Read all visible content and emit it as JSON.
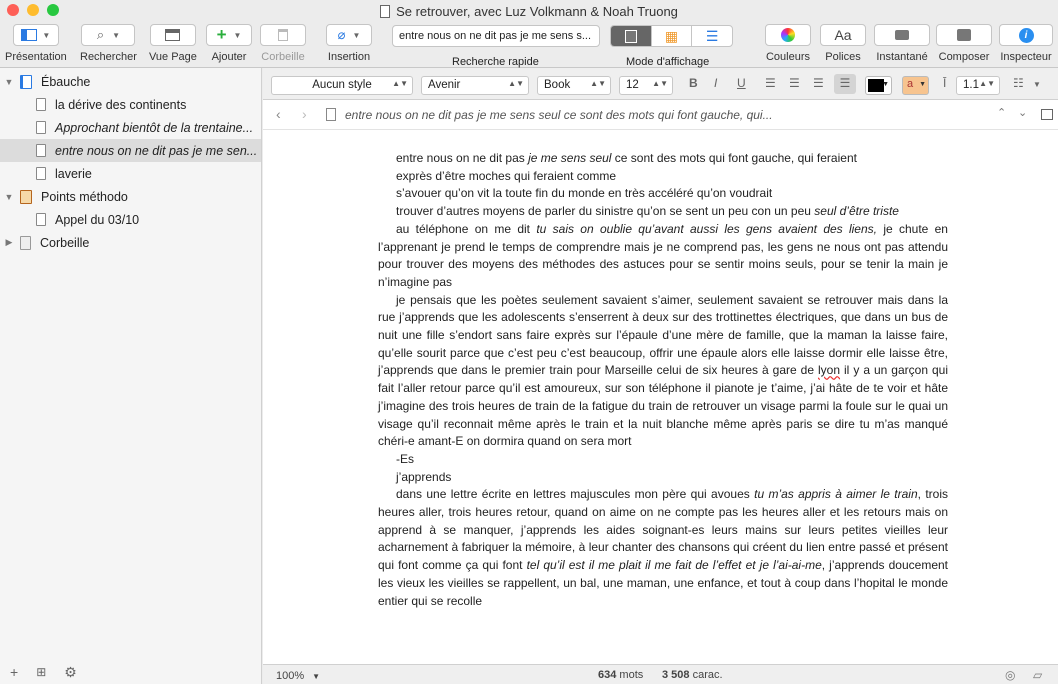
{
  "window": {
    "title": "Se retrouver, avec Luz Volkmann & Noah Truong",
    "colors": {
      "close": "#fe5f57",
      "minimize": "#febc2e",
      "zoom": "#28c840"
    }
  },
  "toolbar": {
    "presentation": "Présentation",
    "rechercher": "Rechercher",
    "vue_page": "Vue Page",
    "ajouter": "Ajouter",
    "corbeille": "Corbeille",
    "insertion": "Insertion",
    "quick_search_value": "entre nous on ne dit pas je me sens s...",
    "quick_search_label": "Recherche rapide",
    "mode_label": "Mode d'affichage",
    "couleurs": "Couleurs",
    "polices": "Polices",
    "instantane": "Instantané",
    "composer": "Composer",
    "inspecteur": "Inspecteur"
  },
  "binder": {
    "items": [
      {
        "label": "Ébauche"
      },
      {
        "label": "la dérive des continents"
      },
      {
        "label": "Approchant bientôt de la trentaine..."
      },
      {
        "label": "entre nous on ne dit pas je me sen..."
      },
      {
        "label": "laverie"
      },
      {
        "label": "Points méthodo"
      },
      {
        "label": "Appel du 03/10"
      },
      {
        "label": "Corbeille"
      }
    ]
  },
  "format": {
    "style": "Aucun style",
    "font": "Avenir",
    "weight": "Book",
    "size": "12",
    "bold": "B",
    "italic": "I",
    "underline": "U",
    "highlight": "a",
    "line_spacing": "1.1"
  },
  "editor_header": {
    "title": "entre nous on ne dit pas je me sens seul ce sont des mots qui font gauche, qui..."
  },
  "document": {
    "l1a": "entre nous on ne dit pas ",
    "l1b": "je me sens seul",
    "l1c": " ce sont des mots qui font gauche, qui feraient",
    "l2": "exprès d’être moches qui feraient comme",
    "l3": "s’avouer qu’on vit la toute fin du monde en très accéléré qu’on voudrait",
    "l4a": "trouver d’autres moyens de parler du sinistre qu’on se sent un peu con un peu ",
    "l4b": "seul d’être triste",
    "p2a": "au téléphone on me dit ",
    "p2b": "tu sais on oublie qu’avant aussi les gens avaient des liens,",
    "p2c": " je chute en l’apprenant je prend le temps de comprendre mais je ne comprend pas, les gens ne nous ont pas attendu pour trouver des moyens des méthodes des astuces pour se sentir moins seuls, pour se tenir la main je n’imagine pas",
    "p3a": "je pensais que les poètes seulement savaient s’aimer, seulement savaient se retrouver mais dans la rue j’apprends que les adolescents s’enserrent à deux sur des trottinettes électriques, que dans un bus de nuit une fille s’endort sans faire exprès sur l’épaule d’une mère de famille, que la maman la laisse faire, qu’elle sourit parce que c’est peu c’est beaucoup, offrir une épaule alors elle laisse dormir elle laisse être, j’apprends que dans le premier train pour Marseille celui de six heures à gare de ",
    "p3b": "lyon",
    "p3c": " il y a un garçon qui fait l’aller retour parce qu’il est amoureux, sur son téléphone il pianote je t’aime, j’ai hâte de te voir et hâte j’imagine des trois heures de train de la fatigue du train de retrouver un visage parmi la foule sur le quai un visage qu’il reconnait même après le train et la nuit blanche même après paris se dire tu m’as manqué chéri-e amant-E on dormira quand on sera mort",
    "p4": "-Es",
    "p5": "j’apprends",
    "p6a": "dans une lettre écrite en lettres majuscules mon père qui avoues ",
    "p6b": "tu m’as appris à aimer le train",
    "p6c": ", trois heures aller, trois heures retour, quand on aime on ne compte pas les heures aller et les retours mais on apprend à se manquer, j’apprends les aides soignant-es leurs mains sur leurs petites vieilles leur acharnement à fabriquer la mémoire, à leur chanter des chansons qui créent du lien entre passé et présent qui font comme ça qui font ",
    "p6d": "tel qu’il est il me plait il me fait de l’effet et je l’ai-ai-me",
    "p6e": ", j’apprends doucement les vieux les vieilles se rappellent, un bal, une maman, une enfance, et tout à coup dans l’hopital le monde entier qui se recolle"
  },
  "footer": {
    "zoom": "100%",
    "words": "634",
    "words_label": "mots",
    "chars": "3 508",
    "chars_label": "carac."
  }
}
